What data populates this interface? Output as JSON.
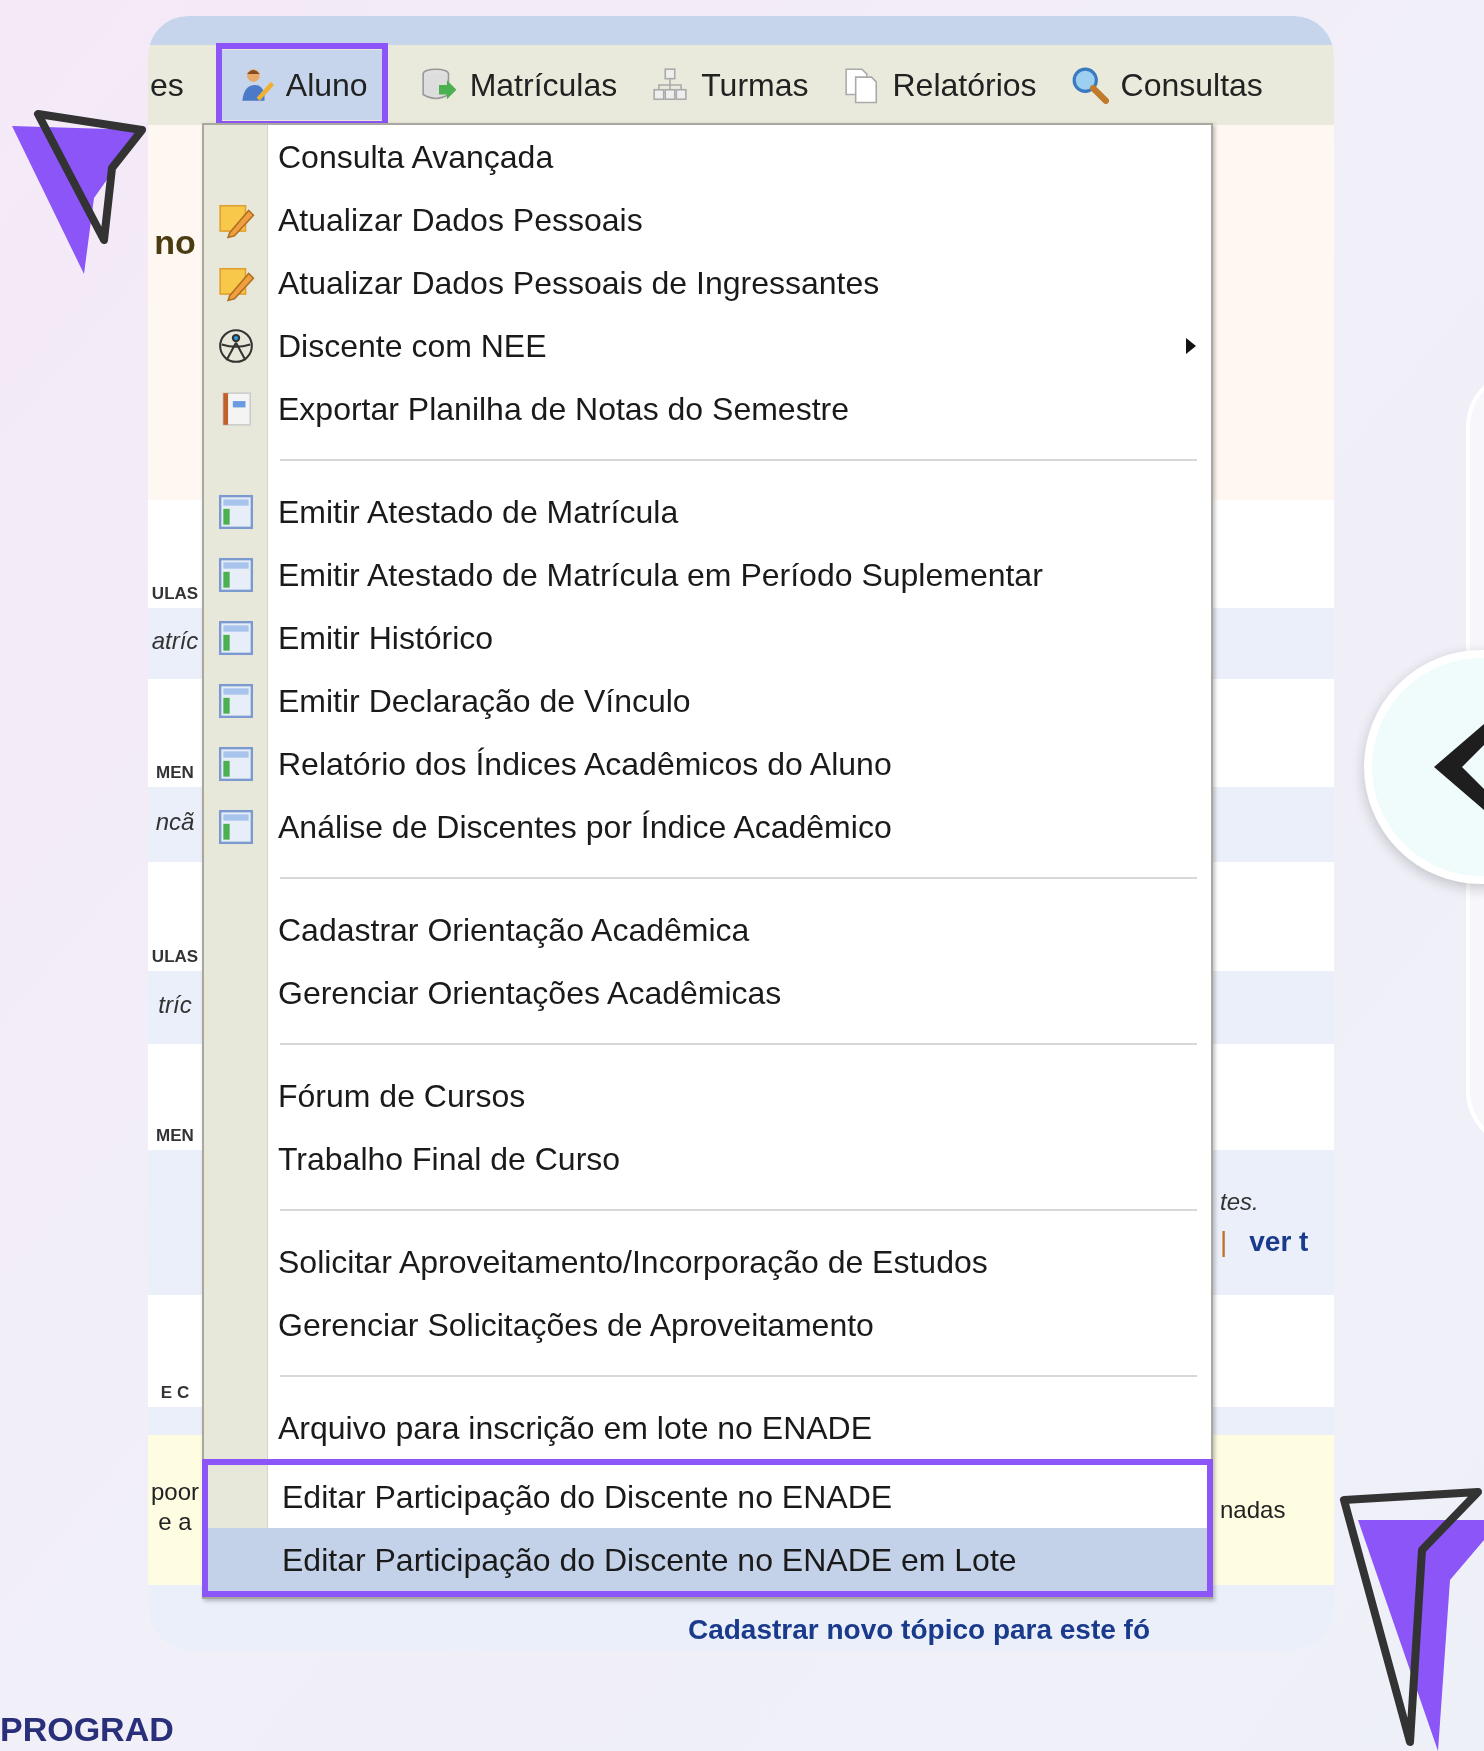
{
  "menu_bar": [
    {
      "label": "es",
      "selected": false
    },
    {
      "label": "Aluno",
      "selected": true
    },
    {
      "label": "Matrículas",
      "selected": false
    },
    {
      "label": "Turmas",
      "selected": false
    },
    {
      "label": "Relatórios",
      "selected": false
    },
    {
      "label": "Consultas",
      "selected": false
    }
  ],
  "dropdown": [
    {
      "kind": "item",
      "label": "Consulta Avançada",
      "submenu": false,
      "selected": false
    },
    {
      "kind": "item",
      "label": "Atualizar Dados Pessoais",
      "submenu": false,
      "selected": false
    },
    {
      "kind": "item",
      "label": "Atualizar Dados Pessoais de Ingressantes",
      "submenu": false,
      "selected": false
    },
    {
      "kind": "item",
      "label": "Discente com NEE",
      "submenu": true,
      "selected": false
    },
    {
      "kind": "item",
      "label": "Exportar Planilha de Notas do Semestre",
      "submenu": false,
      "selected": false
    },
    {
      "kind": "separator"
    },
    {
      "kind": "item",
      "label": "Emitir Atestado de Matrícula",
      "submenu": false,
      "selected": false
    },
    {
      "kind": "item",
      "label": "Emitir Atestado de Matrícula em Período Suplementar",
      "submenu": false,
      "selected": false
    },
    {
      "kind": "item",
      "label": "Emitir Histórico",
      "submenu": false,
      "selected": false
    },
    {
      "kind": "item",
      "label": "Emitir Declaração de Vínculo",
      "submenu": false,
      "selected": false
    },
    {
      "kind": "item",
      "label": "Relatório dos Índices Acadêmicos do Aluno",
      "submenu": false,
      "selected": false
    },
    {
      "kind": "item",
      "label": "Análise de Discentes por Índice Acadêmico",
      "submenu": false,
      "selected": false
    },
    {
      "kind": "separator"
    },
    {
      "kind": "item",
      "label": "Cadastrar Orientação Acadêmica",
      "submenu": false,
      "selected": false
    },
    {
      "kind": "item",
      "label": "Gerenciar Orientações Acadêmicas",
      "submenu": false,
      "selected": false
    },
    {
      "kind": "separator"
    },
    {
      "kind": "item",
      "label": "Fórum de Cursos",
      "submenu": false,
      "selected": false
    },
    {
      "kind": "item",
      "label": "Trabalho Final de Curso",
      "submenu": false,
      "selected": false
    },
    {
      "kind": "separator"
    },
    {
      "kind": "item",
      "label": "Solicitar Aproveitamento/Incorporação de Estudos",
      "submenu": false,
      "selected": false
    },
    {
      "kind": "item",
      "label": "Gerenciar Solicitações de Aproveitamento",
      "submenu": false,
      "selected": false
    },
    {
      "kind": "separator"
    },
    {
      "kind": "item",
      "label": "Arquivo para inscrição em lote no ENADE",
      "submenu": false,
      "selected": false
    },
    {
      "kind": "item",
      "label": "Editar Participação do Discente no ENADE",
      "submenu": false,
      "selected": false
    },
    {
      "kind": "item",
      "label": "Editar Participação do Discente no ENADE em Lote",
      "submenu": false,
      "selected": true
    }
  ],
  "background_rows": [
    {
      "kind": "header",
      "left": [
        {
          "kind": "title",
          "text": "no"
        }
      ]
    },
    {
      "kind": "plain",
      "left": [
        {
          "kind": "heading",
          "text": "ULAS"
        }
      ]
    },
    {
      "kind": "shaded",
      "left": [
        {
          "kind": "italic",
          "text": "atríc"
        }
      ]
    },
    {
      "kind": "plain",
      "left": [
        {
          "kind": "heading",
          "text": "MEN"
        }
      ]
    },
    {
      "kind": "shaded",
      "left": [
        {
          "kind": "italic",
          "text": "ncã"
        }
      ]
    },
    {
      "kind": "plain",
      "left": [
        {
          "kind": "heading",
          "text": "ULAS"
        }
      ]
    },
    {
      "kind": "shaded",
      "left": [
        {
          "kind": "italic",
          "text": "tríc"
        }
      ]
    },
    {
      "kind": "plain",
      "left": [
        {
          "kind": "heading",
          "text": "MEN"
        }
      ]
    },
    {
      "kind": "shaded",
      "right": [
        [
          {
            "kind": "italic",
            "text": "tes."
          }
        ],
        [
          {
            "kind": "divider",
            "text": "|"
          },
          {
            "kind": "link",
            "text": "ver t"
          }
        ]
      ]
    },
    {
      "kind": "plain",
      "left": [
        {
          "kind": "heading",
          "text": "E C"
        }
      ]
    },
    {
      "kind": "shaded"
    },
    {
      "kind": "notice",
      "left": [
        {
          "kind": "plain",
          "text": "poor"
        },
        {
          "kind": "plain",
          "text": "e a"
        }
      ],
      "right": [
        [
          {
            "kind": "plain",
            "text": "nadas"
          }
        ]
      ]
    },
    {
      "kind": "shaded",
      "center": [
        {
          "kind": "link",
          "text": "Cadastrar novo tópico para este fó"
        }
      ]
    }
  ],
  "brand": "PROGRAD"
}
